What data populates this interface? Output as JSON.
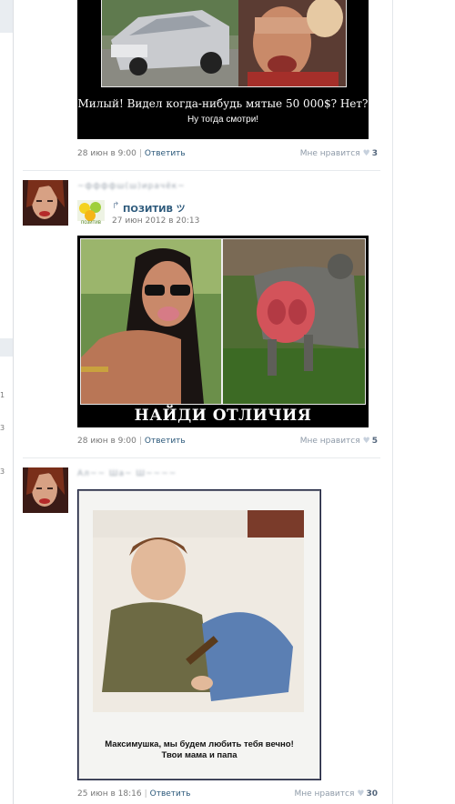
{
  "left_edge": {
    "numbers": [
      "1",
      "3",
      "3"
    ]
  },
  "post1": {
    "caption_line1": "Милый! Видел когда-нибудь мятые 50 000$? Нет?",
    "caption_line2": "Ну тогда смотри!",
    "date": "28 июн в 9:00",
    "reply": "Ответить",
    "like_label": "Мне нравится",
    "like_count": "3"
  },
  "post2": {
    "author": "~ффффш(ш)ирачёк~",
    "group_name": "ПОЗИТИВ ツ",
    "group_date": "27 июн 2012 в 20:13",
    "avatar_label": "позитив",
    "caption": "НАЙДИ ОТЛИЧИЯ",
    "date": "28 июн в 9:00",
    "reply": "Ответить",
    "like_label": "Мне нравится",
    "like_count": "5"
  },
  "post3": {
    "author": "Ал~~ Ша~ Ш~~~~",
    "caption_line1": "Максимушка, мы будем любить тебя вечно!",
    "caption_line2": "Твои мама и папа",
    "date": "25 июн в 18:16",
    "reply": "Ответить",
    "like_label": "Мне нравится",
    "like_count": "30"
  },
  "colors": {
    "link": "#2b587a",
    "meta": "#777777",
    "heart": "#c7d1dd",
    "divider": "#e7eaed"
  }
}
